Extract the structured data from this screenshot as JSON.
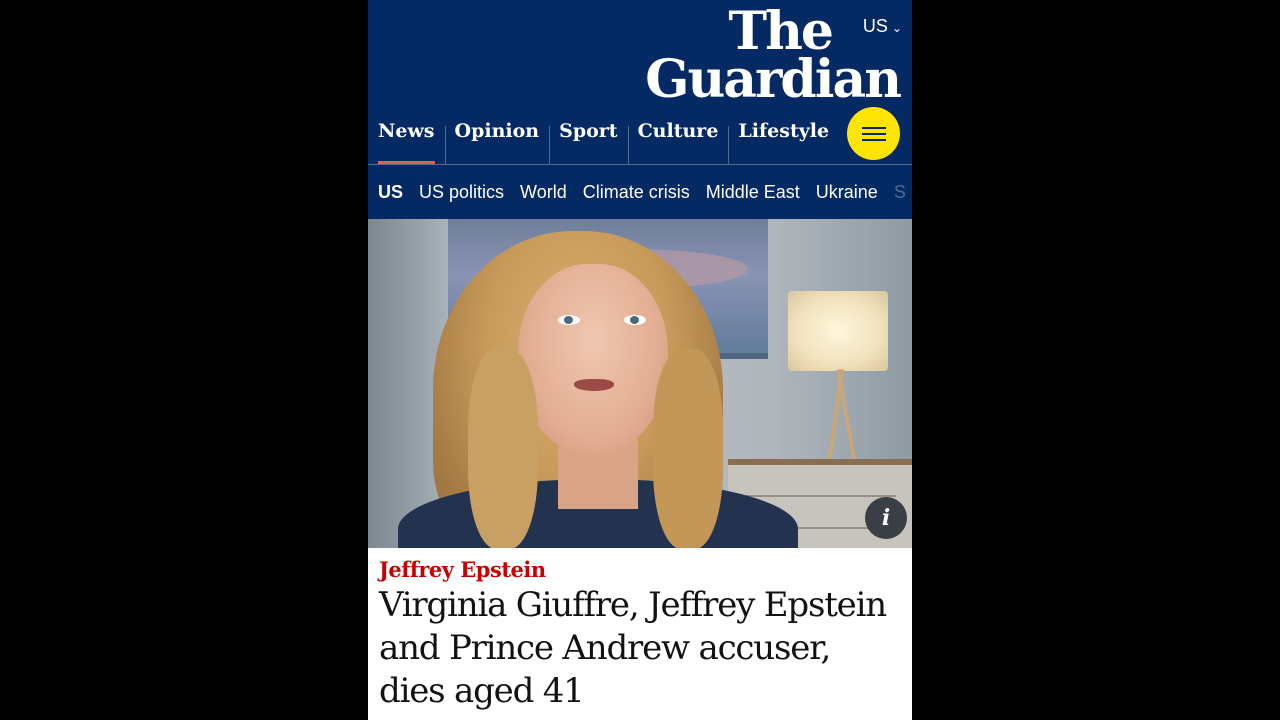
{
  "header": {
    "edition": "US",
    "logo_line1": "The",
    "logo_line2": "Guardian",
    "brand_colors": {
      "navy": "#052962",
      "yellow": "#ffe500",
      "news_red": "#c70000"
    }
  },
  "pillars": [
    {
      "label": "News",
      "active": true
    },
    {
      "label": "Opinion",
      "active": false
    },
    {
      "label": "Sport",
      "active": false
    },
    {
      "label": "Culture",
      "active": false
    },
    {
      "label": "Lifestyle",
      "active": false
    }
  ],
  "menu": {
    "icon": "hamburger-menu-icon"
  },
  "subnav": {
    "items": [
      {
        "label": "US",
        "current": true
      },
      {
        "label": "US politics"
      },
      {
        "label": "World"
      },
      {
        "label": "Climate crisis"
      },
      {
        "label": "Middle East"
      },
      {
        "label": "Ukraine"
      },
      {
        "label": "S"
      }
    ]
  },
  "hero": {
    "info_icon_glyph": "i",
    "info_icon": "info-icon"
  },
  "article": {
    "kicker": "Jeffrey Epstein",
    "headline": "Virginia Giuffre, Jeffrey Epstein and Prince Andrew accuser, dies aged 41"
  }
}
